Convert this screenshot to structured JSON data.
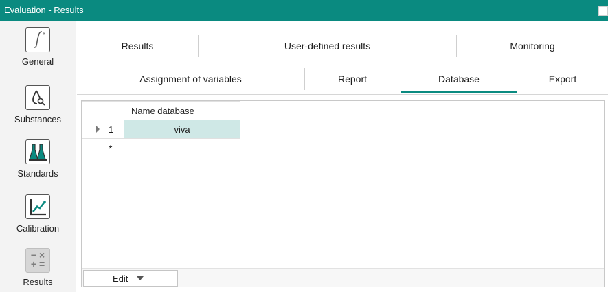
{
  "window": {
    "title": "Evaluation - Results"
  },
  "sidebar": {
    "items": [
      {
        "label": "General",
        "icon": "integral-icon"
      },
      {
        "label": "Substances",
        "icon": "drop-search-icon"
      },
      {
        "label": "Standards",
        "icon": "flasks-icon"
      },
      {
        "label": "Calibration",
        "icon": "calibration-chart-icon"
      },
      {
        "label": "Results",
        "icon": "calculator-icon",
        "active": true
      }
    ]
  },
  "tabs_row1": [
    "Results",
    "User-defined results",
    "Monitoring"
  ],
  "tabs_row2": [
    "Assignment of variables",
    "Report",
    "Database",
    "Export"
  ],
  "active_tab": "Database",
  "grid": {
    "columns": [
      "Name database"
    ],
    "rows": [
      {
        "row_label": "1",
        "name": "viva"
      }
    ],
    "new_row_marker": "*"
  },
  "edit_button": {
    "label": "Edit"
  },
  "colors": {
    "accent": "#0a8a80",
    "selection": "#cfe8e6"
  }
}
